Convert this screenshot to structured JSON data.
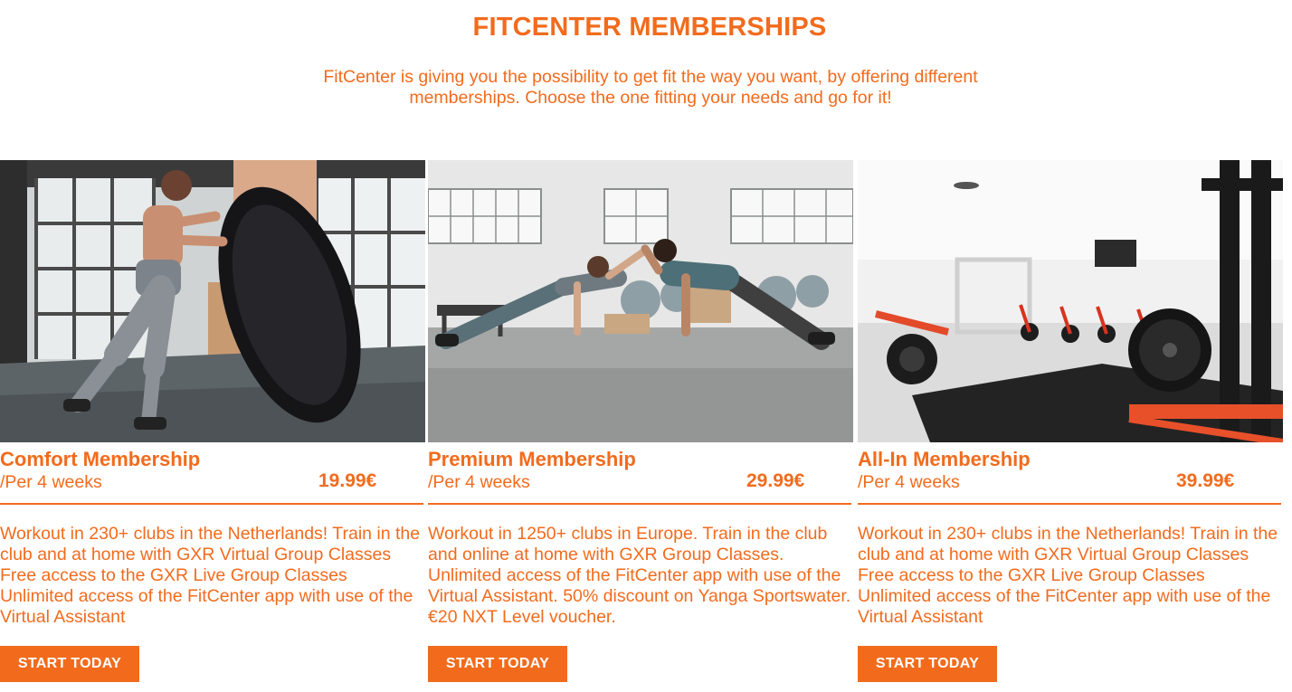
{
  "page": {
    "title": "FITCENTER MEMBERSHIPS",
    "intro": "FitCenter is giving you the possibility to get fit the way you want, by offering different memberships. Choose the one fitting your needs and go for it!"
  },
  "theme": {
    "accent": "#f26b1d",
    "background": "#ffffff",
    "button_text": "#ffffff"
  },
  "memberships": [
    {
      "name": "Comfort Membership",
      "period": "/Per 4 weeks",
      "price": "19.99€",
      "description": "Workout in 230+ clubs in the Netherlands! Train in the club and at home with GXR Virtual Group Classes Free access to the GXR Live Group Classes Unlimited access of the FitCenter app with use of the Virtual Assistant",
      "button": "START TODAY"
    },
    {
      "name": "Premium Membership",
      "period": "/Per 4 weeks",
      "price": "29.99€",
      "description": "Workout in 1250+ clubs in Europe. Train in the club and online at home with GXR Group Classes. Unlimited access of the FitCenter app with use of the Virtual Assistant. 50% discount on Yanga Sportswater. €20 NXT Level voucher.",
      "button": "START TODAY"
    },
    {
      "name": "All-In Membership",
      "period": "/Per 4 weeks",
      "price": "39.99€",
      "description": "Workout in 230+ clubs in the Netherlands! Train in the club and at home with GXR Virtual Group Classes Free access to the GXR Live Group Classes Unlimited access of the FitCenter app with use of the Virtual Assistant",
      "button": "START TODAY"
    }
  ]
}
